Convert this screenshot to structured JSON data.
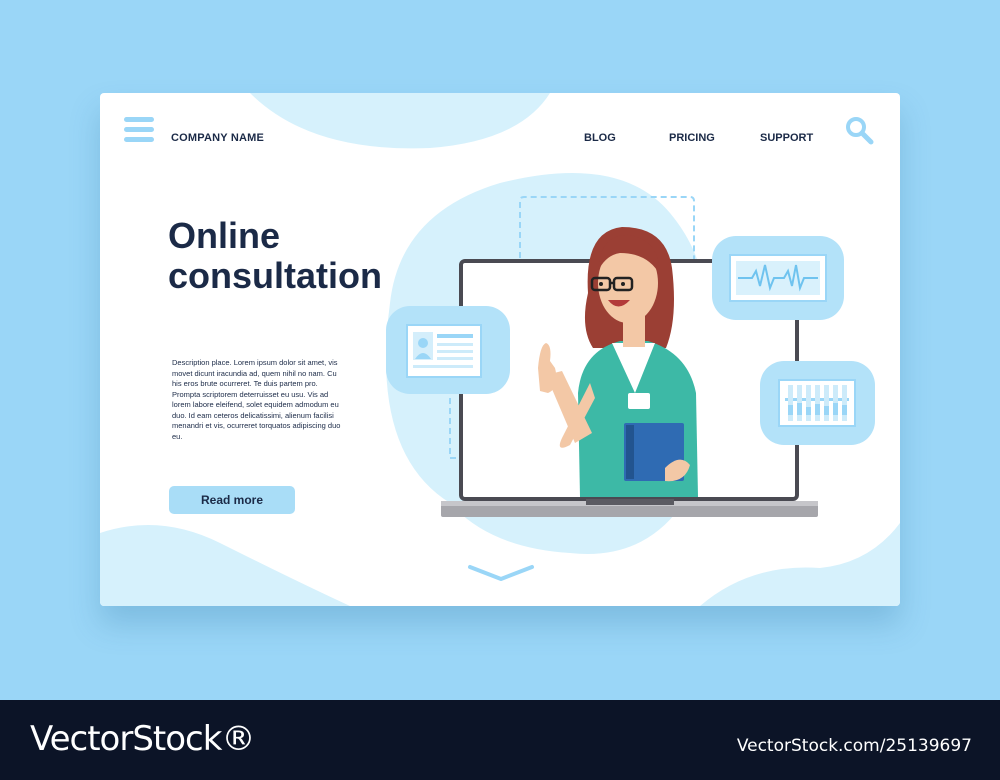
{
  "header": {
    "company_name": "COMPANY NAME",
    "nav": [
      "BLOG",
      "PRICING",
      "SUPPORT"
    ]
  },
  "hero": {
    "title": "Online consultation",
    "description": "Description place. Lorem ipsum dolor sit amet, vis movet dicunt iracundia ad, quem nihil no nam. Cu his eros brute ocurreret. Te duis partem pro. Prompta scriptorem deterruisset eu usu. Vis ad lorem labore eleifend, solet equidem admodum eu duo. Id eam ceteros delicatissimi, alienum facilisi menandri et vis, ocurreret torquatos adipiscing duo eu.",
    "cta_label": "Read more"
  },
  "icons": [
    "menu-icon",
    "search-icon",
    "id-card-icon",
    "heartbeat-icon",
    "test-tubes-icon",
    "chevron-down-icon"
  ],
  "watermark": {
    "brand": "VectorStock®",
    "url": "VectorStock.com/25139697"
  },
  "colors": {
    "background": "#9ad6f7",
    "accent": "#a9ddf7",
    "text": "#1b2a47",
    "footer": "#0c1427"
  }
}
